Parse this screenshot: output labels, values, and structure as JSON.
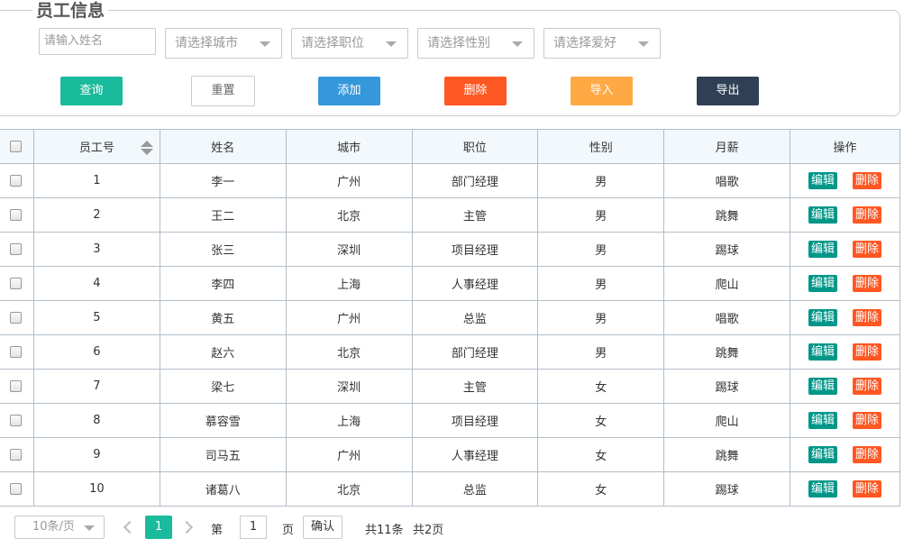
{
  "title": "员工信息",
  "search": {
    "name_placeholder": "请输入姓名",
    "city_placeholder": "请选择城市",
    "position_placeholder": "请选择职位",
    "gender_placeholder": "请选择性别",
    "hobby_placeholder": "请选择爱好"
  },
  "buttons": {
    "query": "查询",
    "reset": "重置",
    "add": "添加",
    "delete": "删除",
    "import": "导入",
    "export": "导出"
  },
  "colors": {
    "query": "#1aba9c",
    "add": "#3498db",
    "delete": "#ff5722",
    "import": "#ffa944",
    "export": "#2f4056",
    "edit": "#009688"
  },
  "table": {
    "headers": [
      "员工号",
      "姓名",
      "城市",
      "职位",
      "性别",
      "月薪",
      "操作"
    ],
    "edit_label": "编辑",
    "delete_label": "删除",
    "rows": [
      {
        "id": "1",
        "name": "李一",
        "city": "广州",
        "position": "部门经理",
        "gender": "男",
        "salary": "唱歌"
      },
      {
        "id": "2",
        "name": "王二",
        "city": "北京",
        "position": "主管",
        "gender": "男",
        "salary": "跳舞"
      },
      {
        "id": "3",
        "name": "张三",
        "city": "深圳",
        "position": "项目经理",
        "gender": "男",
        "salary": "踢球"
      },
      {
        "id": "4",
        "name": "李四",
        "city": "上海",
        "position": "人事经理",
        "gender": "男",
        "salary": "爬山"
      },
      {
        "id": "5",
        "name": "黄五",
        "city": "广州",
        "position": "总监",
        "gender": "男",
        "salary": "唱歌"
      },
      {
        "id": "6",
        "name": "赵六",
        "city": "北京",
        "position": "部门经理",
        "gender": "男",
        "salary": "跳舞"
      },
      {
        "id": "7",
        "name": "梁七",
        "city": "深圳",
        "position": "主管",
        "gender": "女",
        "salary": "踢球"
      },
      {
        "id": "8",
        "name": "慕容雪",
        "city": "上海",
        "position": "项目经理",
        "gender": "女",
        "salary": "爬山"
      },
      {
        "id": "9",
        "name": "司马五",
        "city": "广州",
        "position": "人事经理",
        "gender": "女",
        "salary": "跳舞"
      },
      {
        "id": "10",
        "name": "诸葛八",
        "city": "北京",
        "position": "总监",
        "gender": "女",
        "salary": "踢球"
      }
    ]
  },
  "pager": {
    "page_size": "10条/页",
    "current_page": "1",
    "goto_prefix": "第",
    "goto_value": "1",
    "goto_suffix": "页",
    "confirm": "确认",
    "total_items": "共11条",
    "total_pages": "共2页"
  }
}
